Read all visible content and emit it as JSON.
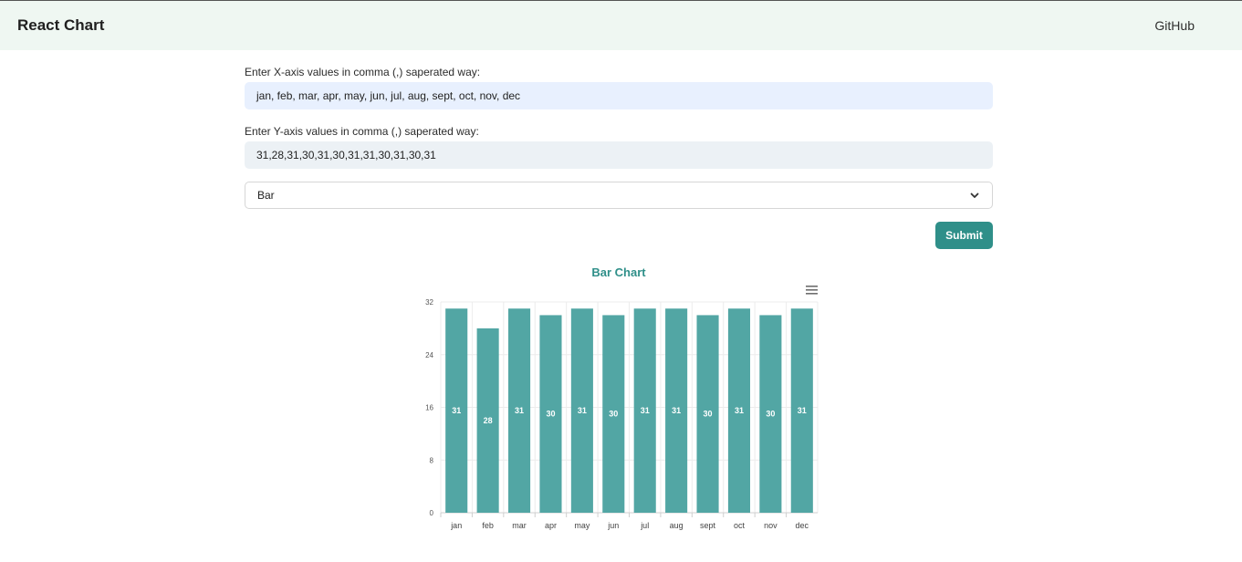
{
  "navbar": {
    "brand": "React Chart",
    "link": "GitHub"
  },
  "form": {
    "x_label": "Enter X-axis values in comma (,) saperated way:",
    "x_value": "jan, feb, mar, apr, may, jun, jul, aug, sept, oct, nov, dec",
    "y_label": "Enter Y-axis values in comma (,) saperated way:",
    "y_value": "31,28,31,30,31,30,31,31,30,31,30,31",
    "chart_type": "Bar",
    "submit_label": "Submit"
  },
  "colors": {
    "accent": "#2f8f89",
    "bar": "#52a6a4",
    "x_input_bg": "#e8f0fe",
    "y_input_bg": "#ecf1f5",
    "navbar_bg": "#eff7f2"
  },
  "icons": {
    "menu": "hamburger-menu-icon",
    "select": "chevron-down-icon"
  },
  "chart_data": {
    "type": "bar",
    "title": "Bar Chart",
    "categories": [
      "jan",
      "feb",
      "mar",
      "apr",
      "may",
      "jun",
      "jul",
      "aug",
      "sept",
      "oct",
      "nov",
      "dec"
    ],
    "values": [
      31,
      28,
      31,
      30,
      31,
      30,
      31,
      31,
      30,
      31,
      30,
      31
    ],
    "yticks": [
      0,
      8,
      16,
      24,
      32
    ],
    "ylim": [
      0,
      32
    ],
    "data_labels": true,
    "grid": true,
    "legend": "none"
  }
}
